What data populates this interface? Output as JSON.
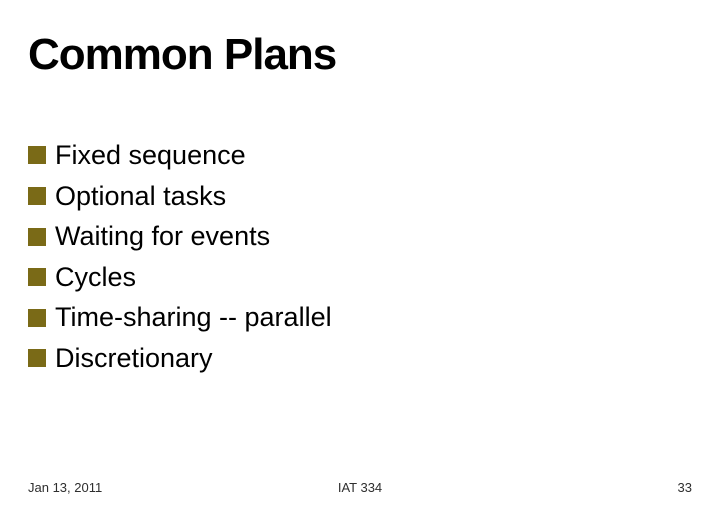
{
  "title": "Common Plans",
  "bullets": [
    {
      "label": "Fixed sequence"
    },
    {
      "label": "Optional tasks"
    },
    {
      "label": "Waiting for events"
    },
    {
      "label": "Cycles"
    },
    {
      "label": "Time-sharing -- parallel"
    },
    {
      "label": "Discretionary"
    }
  ],
  "footer": {
    "date": "Jan 13, 2011",
    "course": "IAT 334",
    "page": "33"
  },
  "colors": {
    "bullet": "#7a6a17"
  }
}
